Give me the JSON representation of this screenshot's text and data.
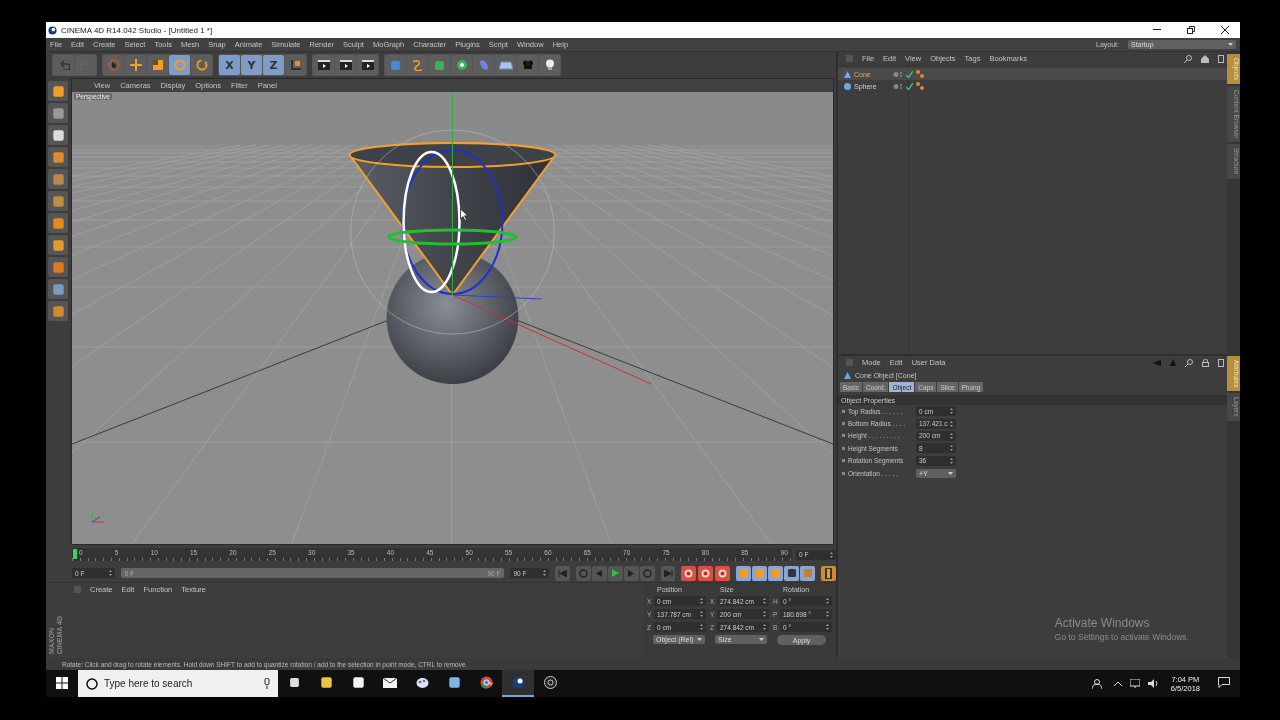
{
  "window": {
    "title": "CINEMA 4D R14.042 Studio - [Untitled 1 *]"
  },
  "menu": [
    "File",
    "Edit",
    "Create",
    "Select",
    "Tools",
    "Mesh",
    "Snap",
    "Animate",
    "Simulate",
    "Render",
    "Sculpt",
    "MoGraph",
    "Character",
    "Plugins",
    "Script",
    "Window",
    "Help"
  ],
  "layout": {
    "label": "Layout:",
    "value": "Startup"
  },
  "toolbar": {
    "tools": [
      {
        "kind": "select",
        "selected": false
      },
      {
        "kind": "move",
        "selected": false
      },
      {
        "kind": "scale",
        "selected": false
      },
      {
        "kind": "rotate",
        "selected": true
      },
      {
        "kind": "recent",
        "selected": false
      }
    ],
    "axes": [
      {
        "label": "X",
        "selected": true
      },
      {
        "label": "Y",
        "selected": true
      },
      {
        "label": "Z",
        "selected": true
      }
    ]
  },
  "viewport": {
    "menu": [
      "View",
      "Cameras",
      "Display",
      "Options",
      "Filter",
      "Panel"
    ],
    "camera": "Perspective"
  },
  "timeline": {
    "ticks": [
      "0",
      "5",
      "10",
      "15",
      "20",
      "25",
      "30",
      "35",
      "40",
      "45",
      "50",
      "55",
      "60",
      "65",
      "70",
      "75",
      "80",
      "85",
      "90"
    ],
    "current_frame": "0 F",
    "start": "0 F",
    "range_start": "0 F",
    "range_end": "90 F",
    "range_slider": {
      "level": 1
    },
    "end": "90 F"
  },
  "material_manager": {
    "menu": [
      "Create",
      "Edit",
      "Function",
      "Texture"
    ]
  },
  "logo": [
    "MAXON",
    "CINEMA 4D"
  ],
  "coordinates": {
    "headers": [
      "Position",
      "Size",
      "Rotation"
    ],
    "rows": [
      {
        "axis": "X",
        "position": "0 cm",
        "size_axis": "X",
        "size": "274.842 cm",
        "rotation_axis": "H",
        "rotation": "0 °"
      },
      {
        "axis": "Y",
        "position": "137.787 cm",
        "size_axis": "Y",
        "size": "200 cm",
        "rotation_axis": "P",
        "rotation": "180.698 °"
      },
      {
        "axis": "Z",
        "position": "0 cm",
        "size_axis": "Z",
        "size": "274.842 cm",
        "rotation_axis": "B",
        "rotation": "0 °"
      }
    ],
    "mode": "Object (Rel)",
    "size_mode": "Size",
    "apply": "Apply"
  },
  "object_manager": {
    "menu": [
      "File",
      "Edit",
      "View",
      "Objects",
      "Tags",
      "Bookmarks"
    ],
    "objects": [
      {
        "name": "Cone",
        "kind": "cone",
        "selected": true
      },
      {
        "name": "Sphere",
        "kind": "sphere",
        "selected": false
      }
    ]
  },
  "side_tabs_top": [
    {
      "label": "Objects",
      "selected": true
    },
    {
      "label": "Content Browser",
      "selected": false
    },
    {
      "label": "Structure",
      "selected": false
    }
  ],
  "attributes": {
    "menu": [
      "Mode",
      "Edit",
      "User Data"
    ],
    "title": "Cone Object [Cone]",
    "tabs": [
      {
        "label": "Basic",
        "selected": false
      },
      {
        "label": "Coord.",
        "selected": false
      },
      {
        "label": "Object",
        "selected": true
      },
      {
        "label": "Caps",
        "selected": false
      },
      {
        "label": "Slice",
        "selected": false
      },
      {
        "label": "Phong",
        "selected": false
      }
    ],
    "section": "Object Properties",
    "fields": [
      {
        "label": "Top Radius . . . . . .",
        "value": "0 cm",
        "kind": "number"
      },
      {
        "label": "Bottom Radius . . . .",
        "value": "137.421 c",
        "kind": "number"
      },
      {
        "label": "Height . . . . . . . . .",
        "value": "200 cm",
        "kind": "number"
      },
      {
        "label": "Height Segments",
        "value": "8",
        "kind": "number"
      },
      {
        "label": "Rotation Segments",
        "value": "36",
        "kind": "number"
      },
      {
        "label": "Orientation . . . . .",
        "value": "+Y",
        "kind": "dropdown"
      }
    ]
  },
  "side_tabs_bottom": [
    {
      "label": "Attributes",
      "selected": true
    },
    {
      "label": "Layers",
      "selected": false
    }
  ],
  "activation": {
    "title": "Activate Windows",
    "text": "Go to Settings to activate Windows."
  },
  "status_bar": "Rotate: Click and drag to rotate elements. Hold down SHIFT to add to quantize rotation / add to the selection in point mode, CTRL to remove.",
  "taskbar": {
    "search_placeholder": "Type here to search",
    "time": "7:04 PM",
    "date": "6/5/2018"
  }
}
